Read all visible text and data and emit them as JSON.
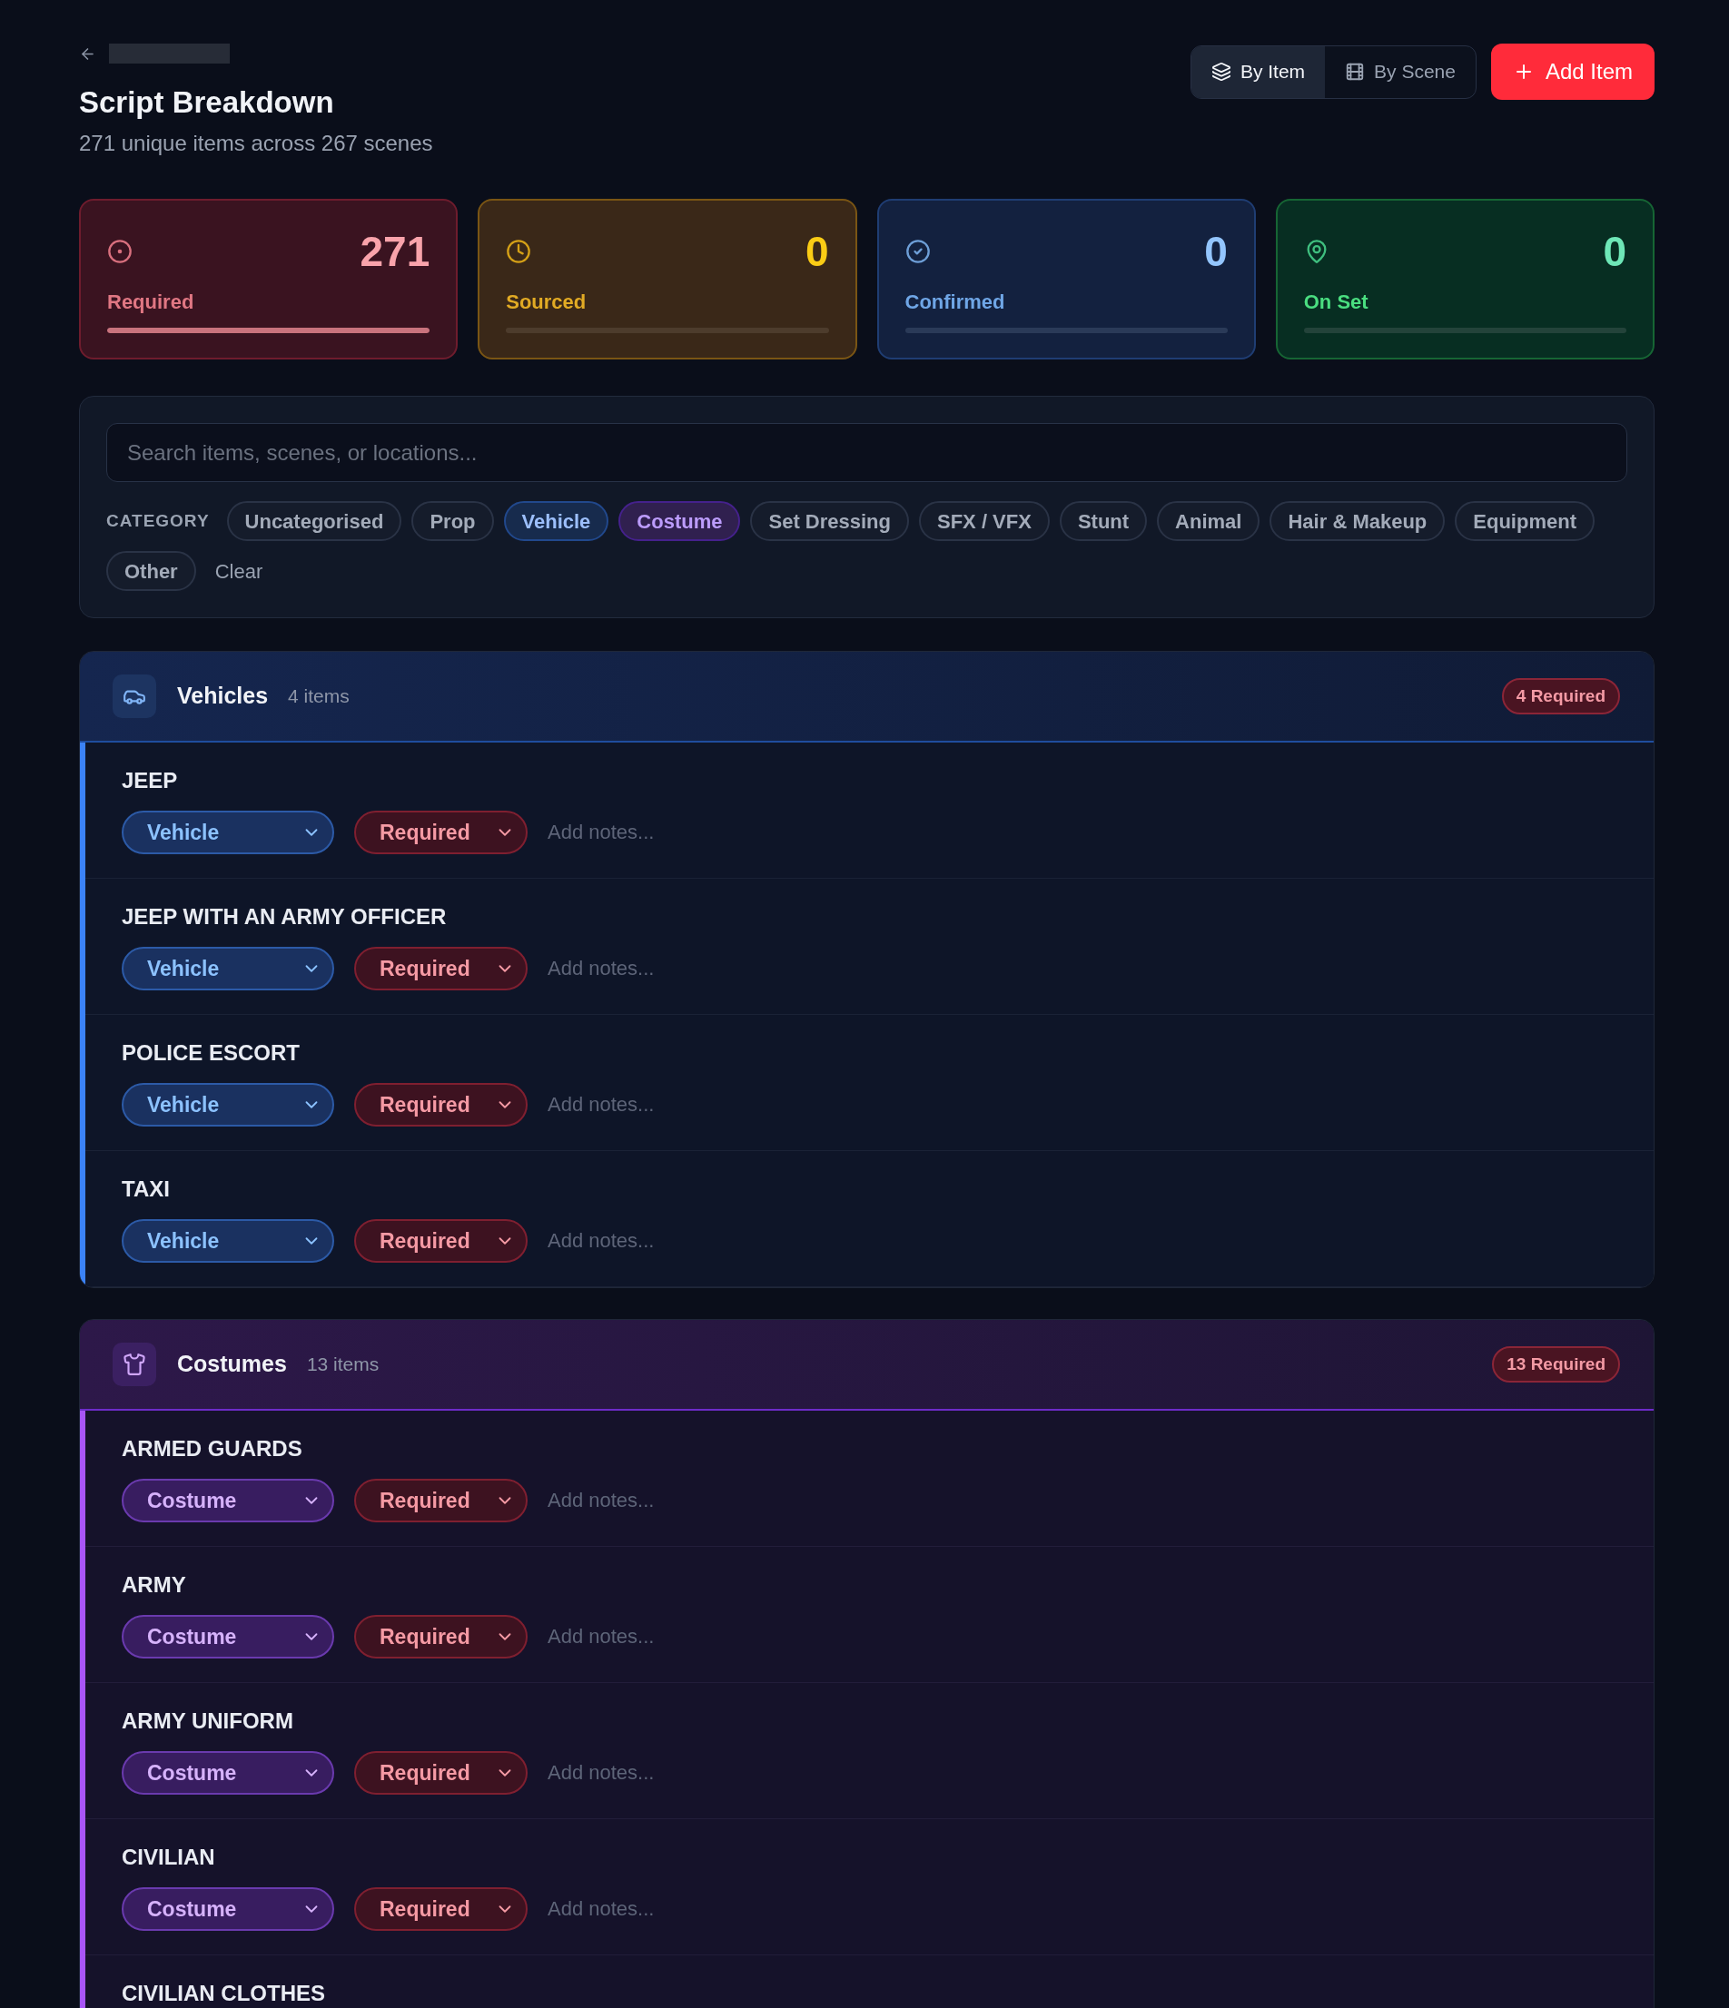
{
  "page": {
    "title": "Script Breakdown",
    "subtitle": "271 unique items across 267 scenes"
  },
  "view_toggle": [
    {
      "label": "By Item",
      "selected": true
    },
    {
      "label": "By Scene",
      "selected": false
    }
  ],
  "add_button": {
    "label": "Add Item"
  },
  "stats": [
    {
      "kind": "required",
      "value": "271",
      "label": "Required",
      "level": 1
    },
    {
      "kind": "sourced",
      "value": "0",
      "label": "Sourced",
      "level": 0
    },
    {
      "kind": "confirmed",
      "value": "0",
      "label": "Confirmed",
      "level": 0
    },
    {
      "kind": "on_set",
      "value": "0",
      "label": "On Set",
      "level": 0
    }
  ],
  "filters": {
    "search": {
      "placeholder": "Search items, scenes, or locations..."
    },
    "category_label": "CATEGORY",
    "categories": [
      {
        "label": "Uncategorised",
        "selected": false
      },
      {
        "label": "Prop",
        "selected": false
      },
      {
        "label": "Vehicle",
        "selected": true,
        "color": "#172b4d"
      },
      {
        "label": "Costume",
        "selected": true,
        "color": "#30204f"
      },
      {
        "label": "Set Dressing",
        "selected": false
      },
      {
        "label": "SFX / VFX",
        "selected": false
      },
      {
        "label": "Stunt",
        "selected": false
      },
      {
        "label": "Animal",
        "selected": false
      },
      {
        "label": "Hair & Makeup",
        "selected": false
      },
      {
        "label": "Equipment",
        "selected": false
      },
      {
        "label": "Other",
        "selected": false
      }
    ],
    "clear": "Clear"
  },
  "sections": [
    {
      "kind": "vehicle",
      "title": "Vehicles",
      "count": "4 items",
      "badge": {
        "label": "4 Required",
        "kind": "required"
      },
      "items": [
        {
          "name": "JEEP",
          "category": "Vehicle",
          "status": {
            "label": "Required",
            "kind": "required"
          },
          "notes": {
            "placeholder": "Add notes..."
          }
        },
        {
          "name": "JEEP WITH AN ARMY OFFICER",
          "category": "Vehicle",
          "status": {
            "label": "Required",
            "kind": "required"
          },
          "notes": {
            "placeholder": "Add notes..."
          }
        },
        {
          "name": "POLICE ESCORT",
          "category": "Vehicle",
          "status": {
            "label": "Required",
            "kind": "required"
          },
          "notes": {
            "placeholder": "Add notes..."
          }
        },
        {
          "name": "TAXI",
          "category": "Vehicle",
          "status": {
            "label": "Required",
            "kind": "required"
          },
          "notes": {
            "placeholder": "Add notes..."
          }
        }
      ]
    },
    {
      "kind": "costume",
      "title": "Costumes",
      "count": "13 items",
      "badge": {
        "label": "13 Required",
        "kind": "required"
      },
      "items": [
        {
          "name": "ARMED GUARDS",
          "category": "Costume",
          "status": {
            "label": "Required",
            "kind": "required"
          },
          "notes": {
            "placeholder": "Add notes..."
          }
        },
        {
          "name": "ARMY",
          "category": "Costume",
          "status": {
            "label": "Required",
            "kind": "required"
          },
          "notes": {
            "placeholder": "Add notes..."
          }
        },
        {
          "name": "ARMY UNIFORM",
          "category": "Costume",
          "status": {
            "label": "Required",
            "kind": "required"
          },
          "notes": {
            "placeholder": "Add notes..."
          }
        },
        {
          "name": "CIVILIAN",
          "category": "Costume",
          "status": {
            "label": "Required",
            "kind": "required"
          },
          "notes": {
            "placeholder": "Add notes..."
          }
        },
        {
          "name": "CIVILIAN CLOTHES"
        }
      ]
    }
  ]
}
